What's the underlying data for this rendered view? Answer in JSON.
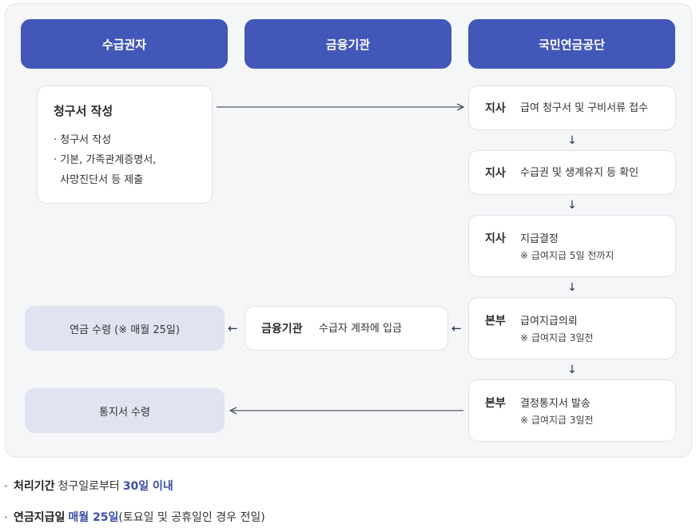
{
  "headers": {
    "recipient": "수급권자",
    "bank": "금융기관",
    "nps": "국민연금공단"
  },
  "claim_card": {
    "title": "청구서 작성",
    "items": [
      "· 청구서 작성",
      "· 기본, 가족관계증명서,",
      "  사망진단서 등 제출"
    ]
  },
  "steps": [
    {
      "who": "지사",
      "desc": "급여 청구서 및 구비서류 접수",
      "note": ""
    },
    {
      "who": "지사",
      "desc": "수급권 및 생계유지 등 확인",
      "note": ""
    },
    {
      "who": "지사",
      "desc": "지급결정",
      "note": "※ 급여지급 5일 전까지"
    },
    {
      "who": "본부",
      "desc": "급여지급의뢰",
      "note": "※ 급여지급 3일전"
    },
    {
      "who": "본부",
      "desc": "결정통지서 발송",
      "note": "※ 급여지급 3일전"
    }
  ],
  "bank_card": {
    "who": "금융기관",
    "desc": "수급자 계좌에 입금"
  },
  "results": {
    "pension": "연금 수령 (※ 매월 25일)",
    "notice": "통지서 수령"
  },
  "arrows": {
    "down": "↓",
    "left": "←"
  },
  "footer": {
    "processing_label": "처리기간",
    "processing_text": "청구일로부터",
    "processing_value": "30일 이내",
    "payday_label": "연금지급일",
    "payday_value": "매월 25일",
    "payday_note": "(토요일 및 공휴일인 경우 전일)"
  }
}
